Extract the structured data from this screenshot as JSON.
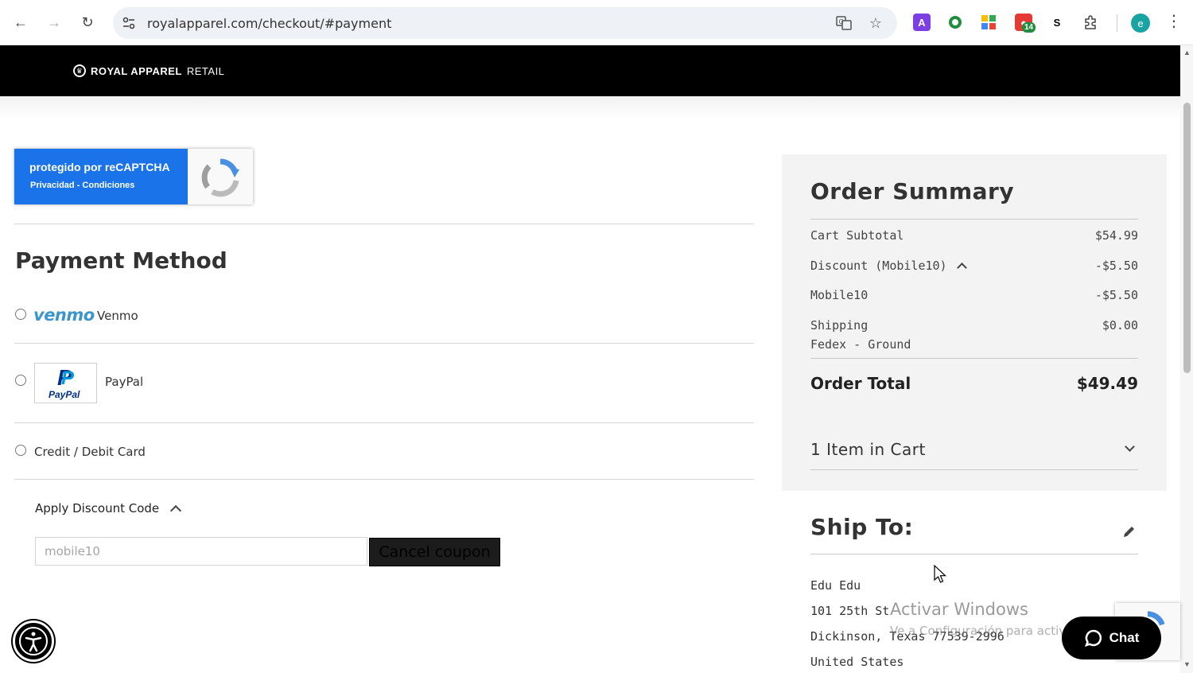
{
  "browser": {
    "url": "royalapparel.com/checkout/#payment",
    "avatar_letter": "e",
    "ext_badge": "14",
    "ext_letter_a": "A",
    "ext_letter_s": "S"
  },
  "site": {
    "brand_bold": "ROYAL APPAREL",
    "brand_light": "RETAIL"
  },
  "recaptcha": {
    "line1": "protegido por reCAPTCHA",
    "line2": "Privacidad - Condiciones"
  },
  "payment": {
    "title": "Payment Method",
    "methods": [
      {
        "logo": "venmo",
        "label": "Venmo"
      },
      {
        "logo": "PayPal",
        "label": "PayPal"
      },
      {
        "label": "Credit / Debit Card"
      }
    ],
    "discount_toggle": "Apply Discount Code",
    "coupon_value": "mobile10",
    "cancel_label": "Cancel coupon"
  },
  "summary": {
    "title": "Order Summary",
    "rows": [
      {
        "label": "Cart Subtotal",
        "value": "$54.99"
      },
      {
        "label": "Discount (Mobile10)",
        "value": "-$5.50"
      },
      {
        "label": "Mobile10",
        "value": "-$5.50"
      },
      {
        "label": "Shipping",
        "sub": "Fedex - Ground",
        "value": "$0.00"
      }
    ],
    "total_label": "Order Total",
    "total_value": "$49.49",
    "cart_label": "1 Item in Cart"
  },
  "ship_to": {
    "title": "Ship To:",
    "lines": [
      "Edu Edu",
      "101 25th St",
      "Dickinson, Texas 77539-2996",
      "United States"
    ]
  },
  "overlay": {
    "watermark_title": "Activar Windows",
    "watermark_sub": "Ve a Configuración para activar Windows.",
    "chat_label": "Chat"
  },
  "colors": {
    "accent_blue": "#1a73e8",
    "venmo": "#3d95ce",
    "paypal_dark": "#003087",
    "header_bg": "#000000"
  }
}
